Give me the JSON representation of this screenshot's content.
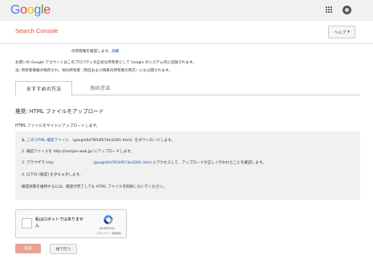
{
  "header": {
    "logo_letters": [
      {
        "char": "G",
        "color": "#4285f4"
      },
      {
        "char": "o",
        "color": "#ea4335"
      },
      {
        "char": "o",
        "color": "#fbbc05"
      },
      {
        "char": "g",
        "color": "#4285f4"
      },
      {
        "char": "l",
        "color": "#34a853"
      },
      {
        "char": "e",
        "color": "#ea4335"
      }
    ],
    "apps_icon": "grid-icon",
    "account_icon": "account-icon"
  },
  "subheader": {
    "product_name": "Search Console",
    "help_label": "ヘルプ",
    "help_chevron": "▾"
  },
  "intro": {
    "line1_text": "の所有権を確認します。",
    "line1_link": "詳細",
    "line2": "お使いの Google アカウントはこのプロパティの正式な所有者として Google のシステム内に記録されます。",
    "line3": "注: 所有者情報が保存され、他の所有者（現在および将来の所有者の両方）にも公開されます。"
  },
  "tabs": {
    "recommended": "おすすめの方法",
    "alternate": "別の方法"
  },
  "method": {
    "title": "推奨: HTML ファイルをアップロード",
    "description": "HTML ファイルをサイトにアップロードします。"
  },
  "steps": {
    "s1_prefix": "1.",
    "s1_link": "この HTML 確認ファイル",
    "s1_file": "（google6d7854f674e326fc.html）",
    "s1_suffix": "をダウンロードします。",
    "s2": "2. 確認ファイルを http://sample-web.jp/ にアップロードします。",
    "s3_prefix": "3. ブラウザで",
    "s3_link1": "http",
    "s3_link2": "/google6d7854f674e326fc.html",
    "s3_suffix": "にアクセスして、アップロードが正しく行われたことを確認します。",
    "s4_prefix": "4. 以下の [確認] を",
    "s4_bold": "クリック",
    "s4_suffix": "します。",
    "note": "確認状態を維持するには、確認が完了しても HTML ファイルを削除しないでください。"
  },
  "recaptcha": {
    "label": "私はロボットではありません",
    "brand": "reCAPTCHA",
    "terms": "プライバシー・利用規約"
  },
  "buttons": {
    "confirm": "確認",
    "later": "後で行う"
  }
}
